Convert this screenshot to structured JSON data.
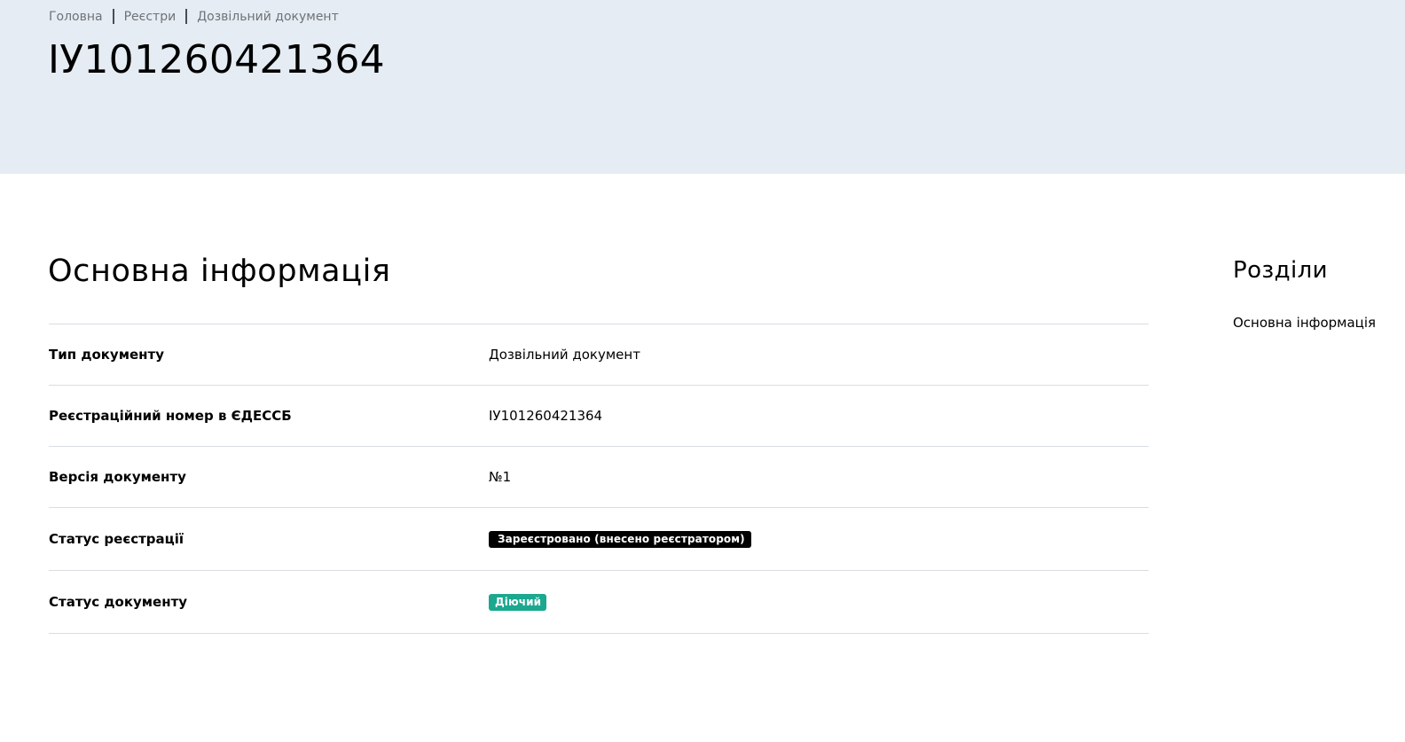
{
  "breadcrumb": {
    "items": [
      {
        "label": "Головна"
      },
      {
        "label": "Реєстри"
      },
      {
        "label": "Дозвільний документ"
      }
    ]
  },
  "header": {
    "title": "ІУ101260421364"
  },
  "main": {
    "section_title": "Основна інформація",
    "rows": [
      {
        "label": "Тип документу",
        "value": "Дозвільний документ"
      },
      {
        "label": "Реєстраційний номер в ЄДЕССБ",
        "value": "ІУ101260421364"
      },
      {
        "label": "Версія документу",
        "value": "№1"
      },
      {
        "label": "Статус реєстрації",
        "value": "Зареєстровано (внесено реєстратором)",
        "badge_color": "#000000"
      },
      {
        "label": "Статус документу",
        "value": "Діючий",
        "badge_color": "#1ba88f"
      }
    ]
  },
  "aside": {
    "title": "Розділи",
    "links": [
      {
        "label": "Основна інформація"
      }
    ]
  },
  "colors": {
    "hero_background": "#e5ecf3",
    "divider": "#d9dde1",
    "breadcrumb_text": "#6f7377"
  }
}
